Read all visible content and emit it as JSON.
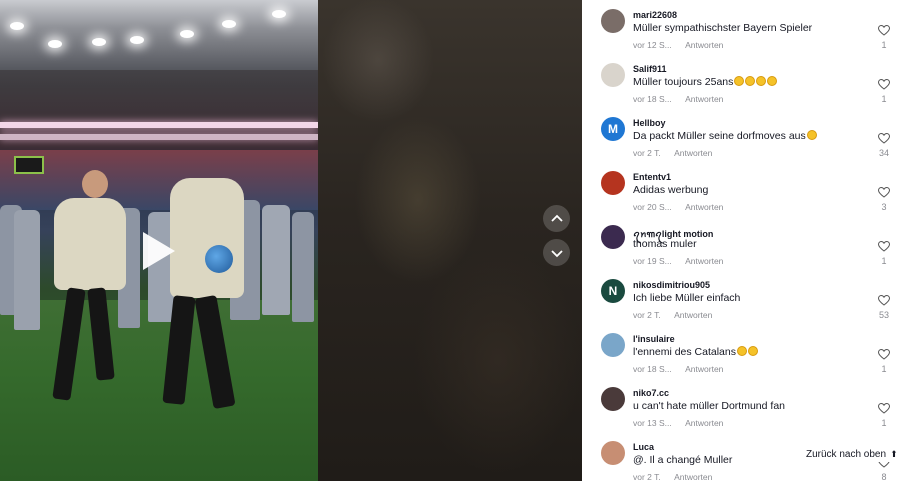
{
  "video": {
    "play_icon": "play-icon",
    "nav_up_icon": "chevron-up-icon",
    "nav_down_icon": "chevron-down-icon"
  },
  "comments": [
    {
      "username": "mari22608",
      "text": "Müller sympathischster Bayern Spieler",
      "emojis": 0,
      "time": "vor 12 S...",
      "reply": "Antworten",
      "likes": "1",
      "avatar_color": "#7a6d68",
      "avatar_letter": ""
    },
    {
      "username": "Salif911",
      "text": "Müller toujours 25ans",
      "emojis": 4,
      "time": "vor 18 S...",
      "reply": "Antworten",
      "likes": "1",
      "avatar_color": "#d9d4cc",
      "avatar_letter": ""
    },
    {
      "username": "Hellboy",
      "text": "Da packt Müller seine dorfmoves aus",
      "emojis": 1,
      "time": "vor 2 T.",
      "reply": "Antworten",
      "likes": "34",
      "avatar_color": "#1f77d3",
      "avatar_letter": "M"
    },
    {
      "username": "Ententv1",
      "text": "Adidas werbung",
      "emojis": 0,
      "time": "vor 20 S...",
      "reply": "Antworten",
      "likes": "3",
      "avatar_color": "#b5341f",
      "avatar_letter": ""
    },
    {
      "username": "ꪖꪀ꧑ꪖlight motion",
      "text": "thomas muler",
      "emojis": 0,
      "time": "vor 19 S...",
      "reply": "Antworten",
      "likes": "1",
      "avatar_color": "#3b2a4f",
      "avatar_letter": ""
    },
    {
      "username": "nikosdimitriou905",
      "text": "Ich liebe Müller einfach",
      "emojis": 0,
      "time": "vor 2 T.",
      "reply": "Antworten",
      "likes": "53",
      "avatar_color": "#1a4a3f",
      "avatar_letter": "N"
    },
    {
      "username": "l'insulaire",
      "text": "l'ennemi des Catalans",
      "emojis": 2,
      "time": "vor 18 S...",
      "reply": "Antworten",
      "likes": "1",
      "avatar_color": "#7aa6c9",
      "avatar_letter": ""
    },
    {
      "username": "niko7.cc",
      "text": "u can't hate müller Dortmund fan",
      "emojis": 0,
      "time": "vor 13 S...",
      "reply": "Antworten",
      "likes": "1",
      "avatar_color": "#4a3a3a",
      "avatar_letter": ""
    },
    {
      "username": "Luca",
      "text": "@. Il a changé Muller",
      "emojis": 0,
      "time": "vor 2 T.",
      "reply": "Antworten",
      "likes": "8",
      "avatar_color": "#c78e73",
      "avatar_letter": ""
    }
  ],
  "back_to_top": {
    "label": "Zurück nach oben",
    "icon": "double-chevron-up-icon"
  },
  "colors": {
    "text": "#161823",
    "muted": "#8a8b91"
  }
}
